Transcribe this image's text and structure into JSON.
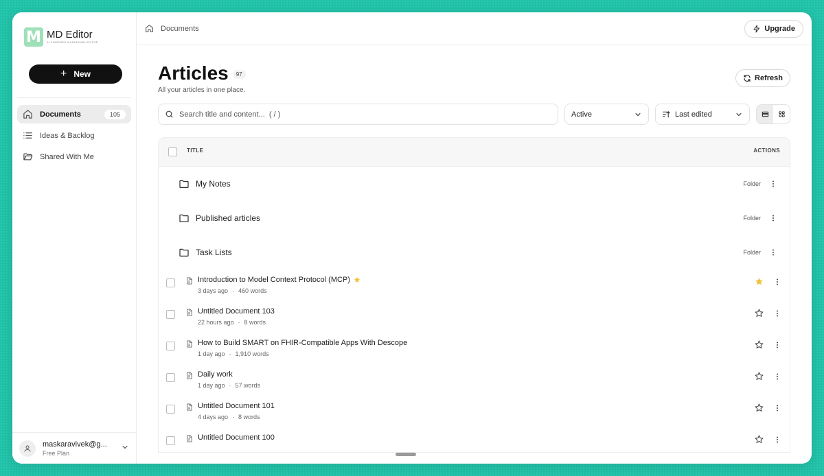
{
  "app": {
    "name": "MD Editor",
    "tagline": "AI POWERED MARKDOWN EDITOR",
    "logo_letter": "M"
  },
  "sidebar": {
    "new_label": "New",
    "items": [
      {
        "label": "Documents",
        "count": "105",
        "icon": "home-icon",
        "active": true
      },
      {
        "label": "Ideas & Backlog",
        "icon": "list-icon"
      },
      {
        "label": "Shared With Me",
        "icon": "folder-open-icon"
      }
    ]
  },
  "user": {
    "name": "maskaravivek@g...",
    "plan": "Free Plan"
  },
  "topbar": {
    "breadcrumb": "Documents",
    "upgrade_label": "Upgrade"
  },
  "page": {
    "title": "Articles",
    "count": "97",
    "subtitle": "All your articles in one place.",
    "refresh_label": "Refresh"
  },
  "filters": {
    "search_placeholder": "Search title and content...  ( / )",
    "status_value": "Active",
    "sort_value": "Last edited"
  },
  "table": {
    "col_title": "TITLE",
    "col_actions": "ACTIONS",
    "folders": [
      {
        "name": "My Notes",
        "type": "Folder"
      },
      {
        "name": "Published articles",
        "type": "Folder"
      },
      {
        "name": "Task Lists",
        "type": "Folder"
      }
    ],
    "docs": [
      {
        "title": "Introduction to Model Context Protocol (MCP)",
        "time": "3 days ago",
        "words": "460 words",
        "starred": true
      },
      {
        "title": "Untitled Document 103",
        "time": "22 hours ago",
        "words": "8 words",
        "starred": false
      },
      {
        "title": "How to Build SMART on FHIR-Compatible Apps With Descope",
        "time": "1 day ago",
        "words": "1,910 words",
        "starred": false
      },
      {
        "title": "Daily work",
        "time": "1 day ago",
        "words": "57 words",
        "starred": false
      },
      {
        "title": "Untitled Document 101",
        "time": "4 days ago",
        "words": "8 words",
        "starred": false
      },
      {
        "title": "Untitled Document 100",
        "time": "",
        "words": "",
        "starred": false
      }
    ]
  },
  "colors": {
    "background": "#1fc2a8",
    "logo": "#9fe0b9",
    "star": "#f0c23a",
    "primary_button": "#111111"
  }
}
